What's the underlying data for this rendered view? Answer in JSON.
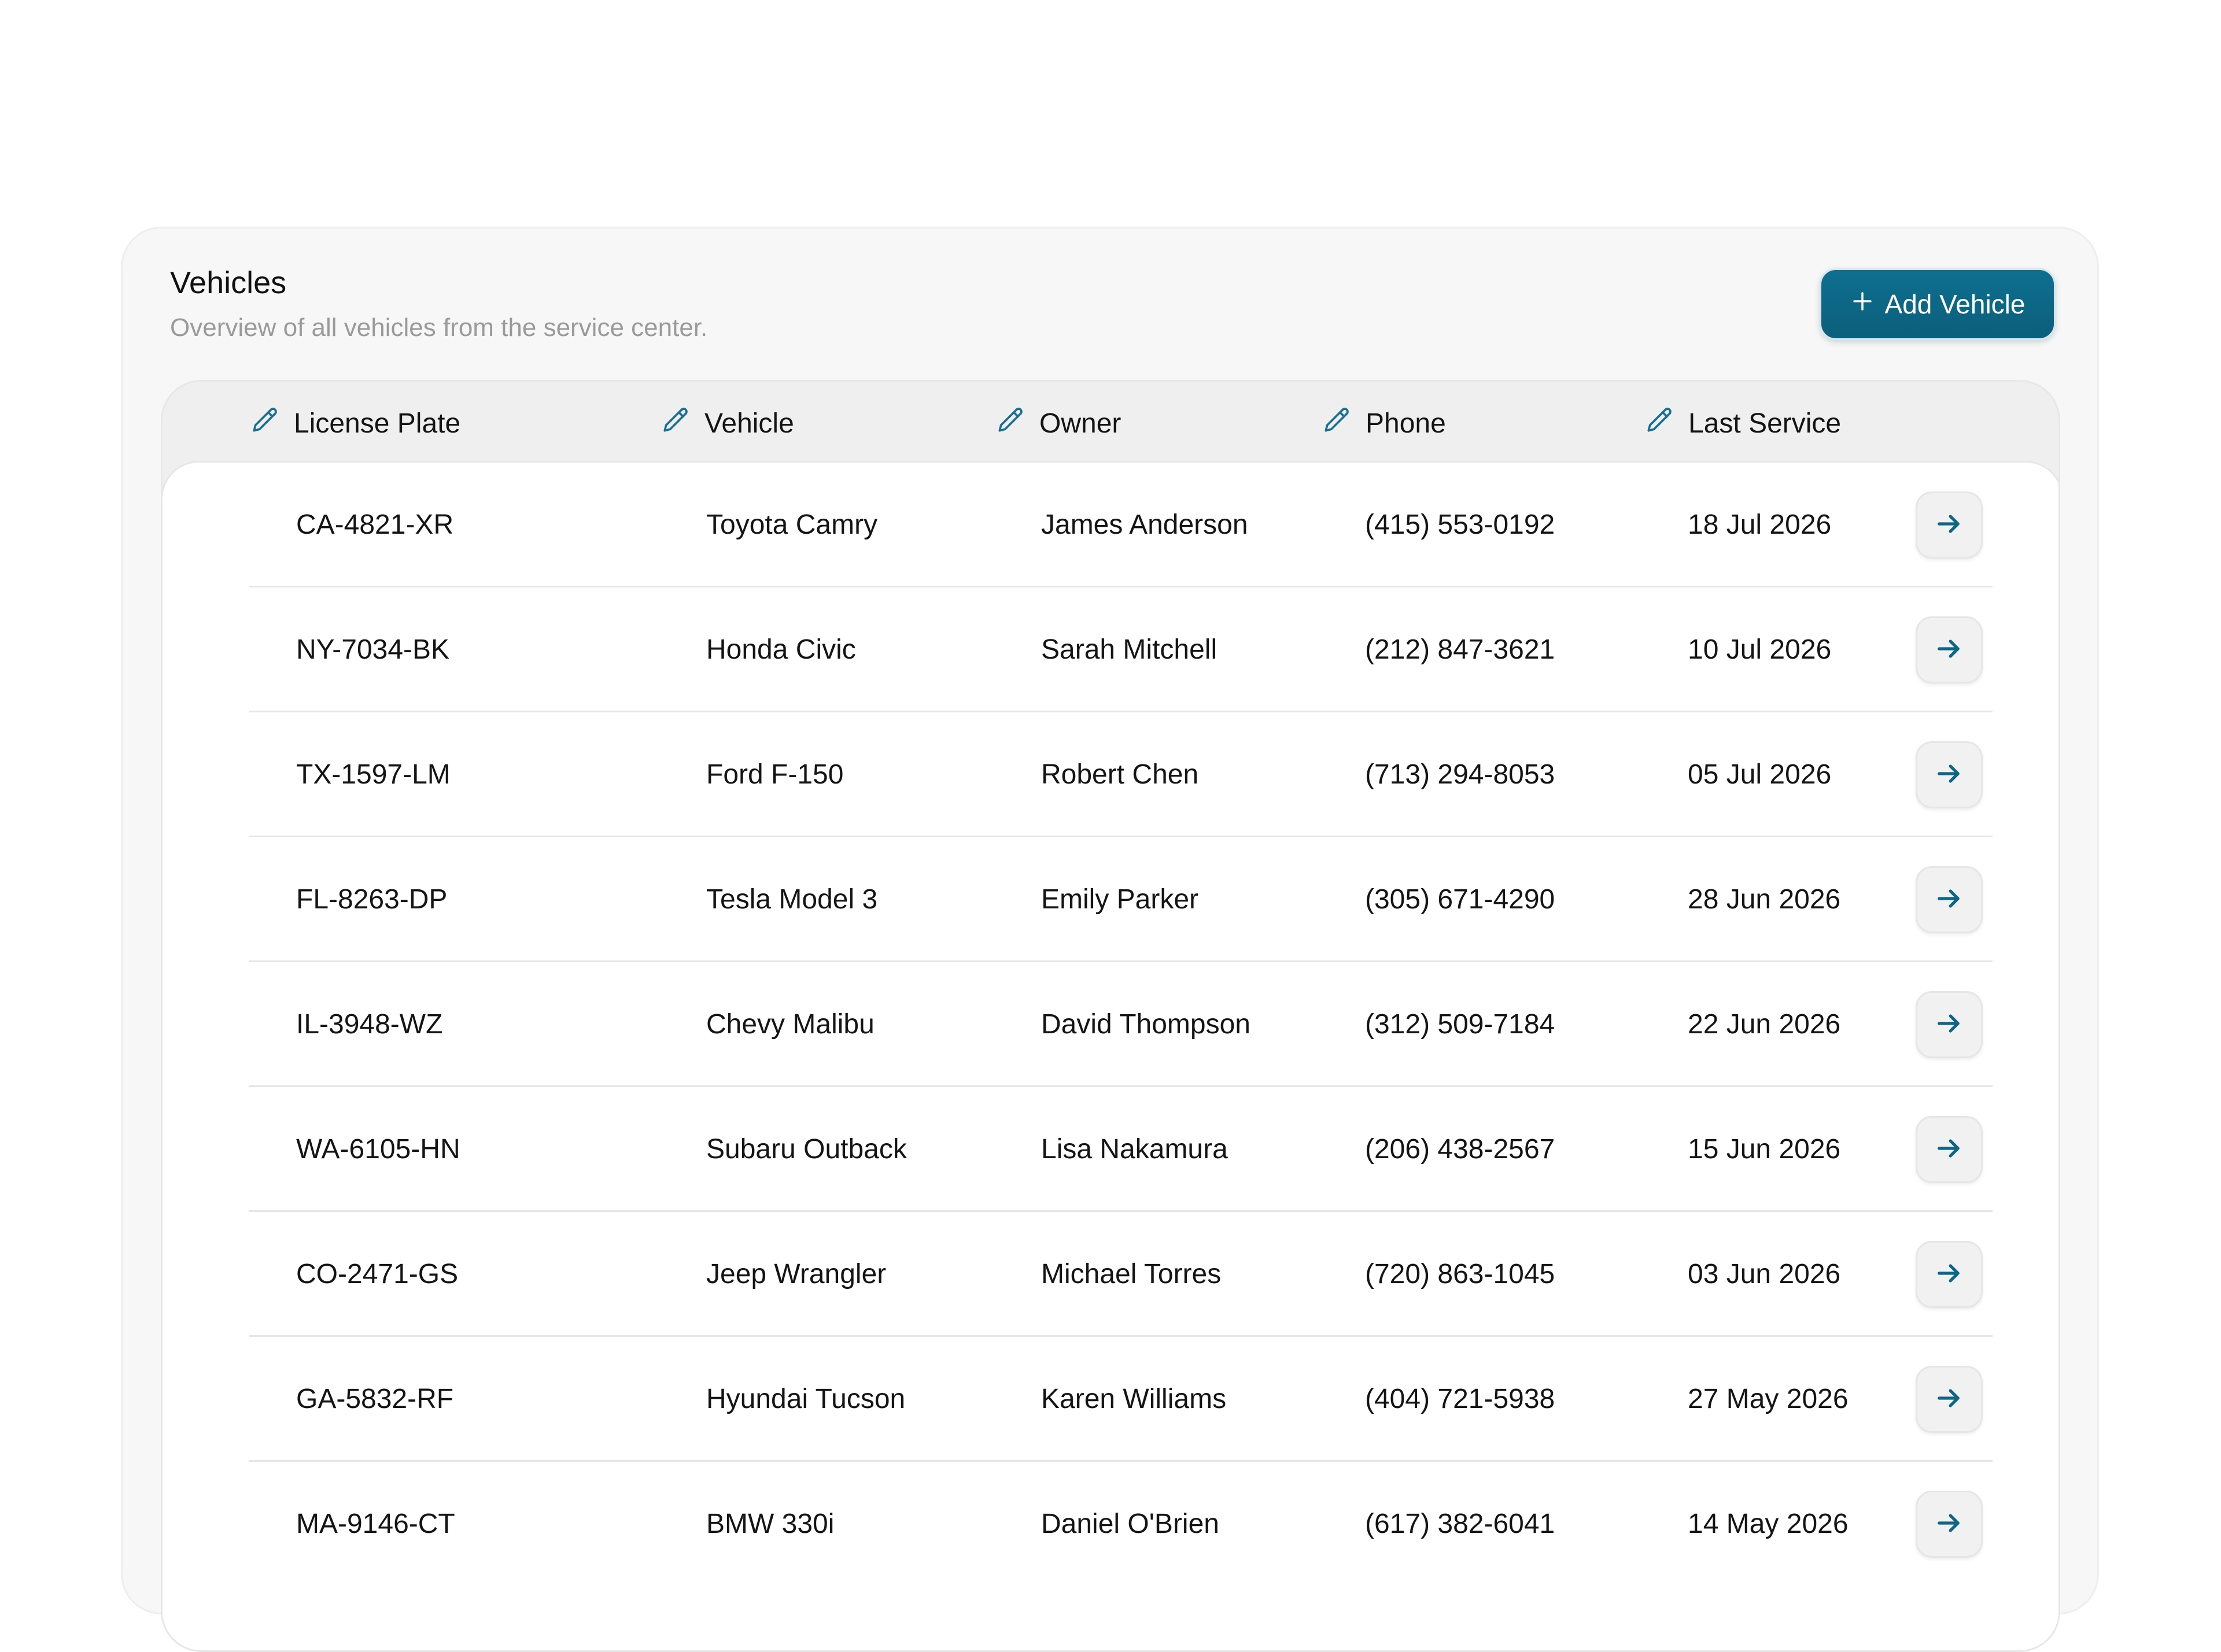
{
  "header": {
    "title": "Vehicles",
    "subtitle": "Overview of all vehicles from the service center.",
    "add_button_label": "Add Vehicle",
    "add_button_icon": "plus-icon"
  },
  "colors": {
    "accent": "#0c6684",
    "header_icon": "#1d6f8f",
    "arrow_icon": "#0c6684",
    "muted_text": "#9a9a9a"
  },
  "table": {
    "columns": [
      {
        "label": "License Plate",
        "icon": "pencil-icon"
      },
      {
        "label": "Vehicle",
        "icon": "pencil-icon"
      },
      {
        "label": "Owner",
        "icon": "pencil-icon"
      },
      {
        "label": "Phone",
        "icon": "pencil-icon"
      },
      {
        "label": "Last Service",
        "icon": "pencil-icon"
      }
    ],
    "rows": [
      {
        "plate": "CA-4821-XR",
        "vehicle": "Toyota Camry",
        "owner": "James Anderson",
        "phone": "(415) 553-0192",
        "last_service": "18 Jul 2026"
      },
      {
        "plate": "NY-7034-BK",
        "vehicle": "Honda Civic",
        "owner": "Sarah Mitchell",
        "phone": "(212) 847-3621",
        "last_service": "10 Jul 2026"
      },
      {
        "plate": "TX-1597-LM",
        "vehicle": "Ford F-150",
        "owner": "Robert Chen",
        "phone": "(713) 294-8053",
        "last_service": "05 Jul 2026"
      },
      {
        "plate": "FL-8263-DP",
        "vehicle": "Tesla Model 3",
        "owner": "Emily Parker",
        "phone": "(305) 671-4290",
        "last_service": "28 Jun 2026"
      },
      {
        "plate": "IL-3948-WZ",
        "vehicle": "Chevy Malibu",
        "owner": "David Thompson",
        "phone": "(312) 509-7184",
        "last_service": "22 Jun 2026"
      },
      {
        "plate": "WA-6105-HN",
        "vehicle": "Subaru Outback",
        "owner": "Lisa Nakamura",
        "phone": "(206) 438-2567",
        "last_service": "15 Jun 2026"
      },
      {
        "plate": "CO-2471-GS",
        "vehicle": "Jeep Wrangler",
        "owner": "Michael Torres",
        "phone": "(720) 863-1045",
        "last_service": "03 Jun 2026"
      },
      {
        "plate": "GA-5832-RF",
        "vehicle": "Hyundai Tucson",
        "owner": "Karen Williams",
        "phone": "(404) 721-5938",
        "last_service": "27 May 2026"
      },
      {
        "plate": "MA-9146-CT",
        "vehicle": "BMW 330i",
        "owner": "Daniel O'Brien",
        "phone": "(617) 382-6041",
        "last_service": "14 May 2026"
      }
    ],
    "row_action_icon": "arrow-right-icon"
  }
}
